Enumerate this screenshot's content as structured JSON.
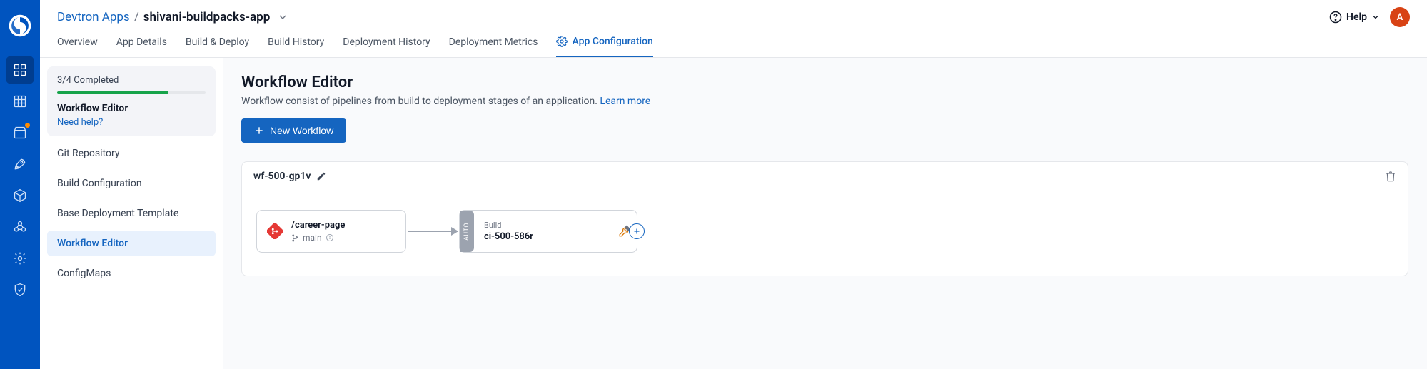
{
  "breadcrumb": {
    "root": "Devtron Apps",
    "sep": "/",
    "leaf": "shivani-buildpacks-app"
  },
  "header": {
    "help": "Help",
    "avatar": "A"
  },
  "tabs": [
    "Overview",
    "App Details",
    "Build & Deploy",
    "Build History",
    "Deployment History",
    "Deployment Metrics",
    "App Configuration"
  ],
  "active_tab": 6,
  "side": {
    "progress_text": "3/4 Completed",
    "progress_percent": 75,
    "progress_title": "Workflow Editor",
    "progress_help": "Need help?",
    "items": [
      "Git Repository",
      "Build Configuration",
      "Base Deployment Template",
      "Workflow Editor",
      "ConfigMaps"
    ],
    "active_index": 3
  },
  "page": {
    "title": "Workflow Editor",
    "desc": "Workflow consist of pipelines from build to deployment stages of an application. ",
    "learn": "Learn more",
    "new_btn": "New Workflow"
  },
  "workflow": {
    "name": "wf-500-gp1v",
    "source": {
      "path": "/career-page",
      "branch": "main"
    },
    "build": {
      "auto": "AUTO",
      "label": "Build",
      "name": "ci-500-586r"
    }
  }
}
